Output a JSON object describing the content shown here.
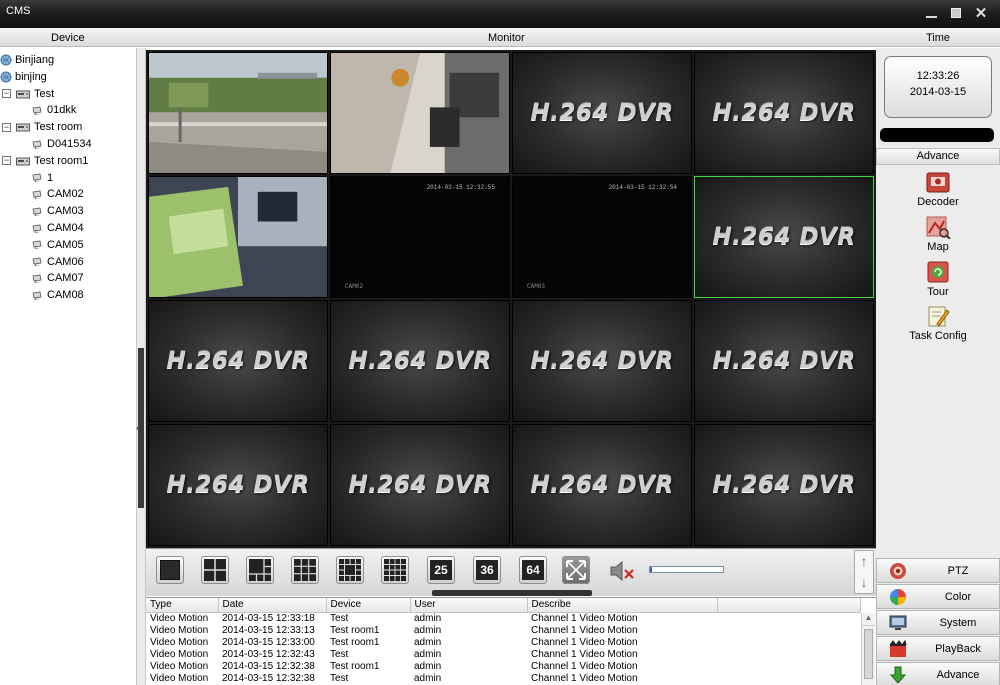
{
  "window": {
    "title": "CMS"
  },
  "header": {
    "device": "Device",
    "monitor": "Monitor",
    "time": "Time"
  },
  "tree": {
    "nodes": [
      {
        "label": "Binjiang",
        "kind": "group"
      },
      {
        "label": "binjing",
        "kind": "group"
      },
      {
        "label": "Test",
        "kind": "dvr",
        "expander": "−"
      },
      {
        "label": "01dkk",
        "kind": "camera"
      },
      {
        "label": "Test room",
        "kind": "dvr",
        "expander": "−"
      },
      {
        "label": "D041534",
        "kind": "camera"
      },
      {
        "label": "Test room1",
        "kind": "dvr",
        "expander": "−"
      },
      {
        "label": "1",
        "kind": "camera"
      },
      {
        "label": "CAM02",
        "kind": "camera"
      },
      {
        "label": "CAM03",
        "kind": "camera"
      },
      {
        "label": "CAM04",
        "kind": "camera"
      },
      {
        "label": "CAM05",
        "kind": "camera"
      },
      {
        "label": "CAM06",
        "kind": "camera"
      },
      {
        "label": "CAM07",
        "kind": "camera"
      },
      {
        "label": "CAM08",
        "kind": "camera"
      }
    ]
  },
  "monitor": {
    "placeholder_text": "H.264 DVR",
    "osd_time": "2014-03-15 12:32:55",
    "osd_time2": "2014-03-15 12:32:54",
    "osd_ch": "CAM02",
    "osd_ch2": "CAM03",
    "selected_cell": 8
  },
  "clock": {
    "time": "12:33:26",
    "date": "2014-03-15"
  },
  "advance_panel": {
    "heading": "Advance",
    "items": [
      {
        "label": "Decoder",
        "icon": "decoder-icon"
      },
      {
        "label": "Map",
        "icon": "map-icon"
      },
      {
        "label": "Tour",
        "icon": "tour-icon"
      },
      {
        "label": "Task Config",
        "icon": "task-config-icon"
      }
    ]
  },
  "menu": {
    "items": [
      {
        "label": "PTZ",
        "icon": "ptz-icon"
      },
      {
        "label": "Color",
        "icon": "color-icon"
      },
      {
        "label": "System",
        "icon": "system-icon"
      },
      {
        "label": "PlayBack",
        "icon": "playback-icon"
      },
      {
        "label": "Advance",
        "icon": "advance-icon"
      }
    ]
  },
  "toolbar": {
    "layouts": [
      "1",
      "4",
      "6",
      "9",
      "10",
      "16"
    ],
    "num_layouts": [
      "25",
      "36",
      "64"
    ],
    "volume_level": 0.03
  },
  "log": {
    "columns": [
      "Type",
      "Date",
      "Device",
      "User",
      "Describe"
    ],
    "rows": [
      [
        "Video Motion",
        "2014-03-15 12:33:18",
        "Test",
        "admin",
        "Channel 1 Video Motion"
      ],
      [
        "Video Motion",
        "2014-03-15 12:33:13",
        "Test room1",
        "admin",
        "Channel 1 Video Motion"
      ],
      [
        "Video Motion",
        "2014-03-15 12:33:00",
        "Test room1",
        "admin",
        "Channel 1 Video Motion"
      ],
      [
        "Video Motion",
        "2014-03-15 12:32:43",
        "Test",
        "admin",
        "Channel 1 Video Motion"
      ],
      [
        "Video Motion",
        "2014-03-15 12:32:38",
        "Test room1",
        "admin",
        "Channel 1 Video Motion"
      ],
      [
        "Video Motion",
        "2014-03-15 12:32:38",
        "Test",
        "admin",
        "Channel 1 Video Motion"
      ]
    ]
  }
}
